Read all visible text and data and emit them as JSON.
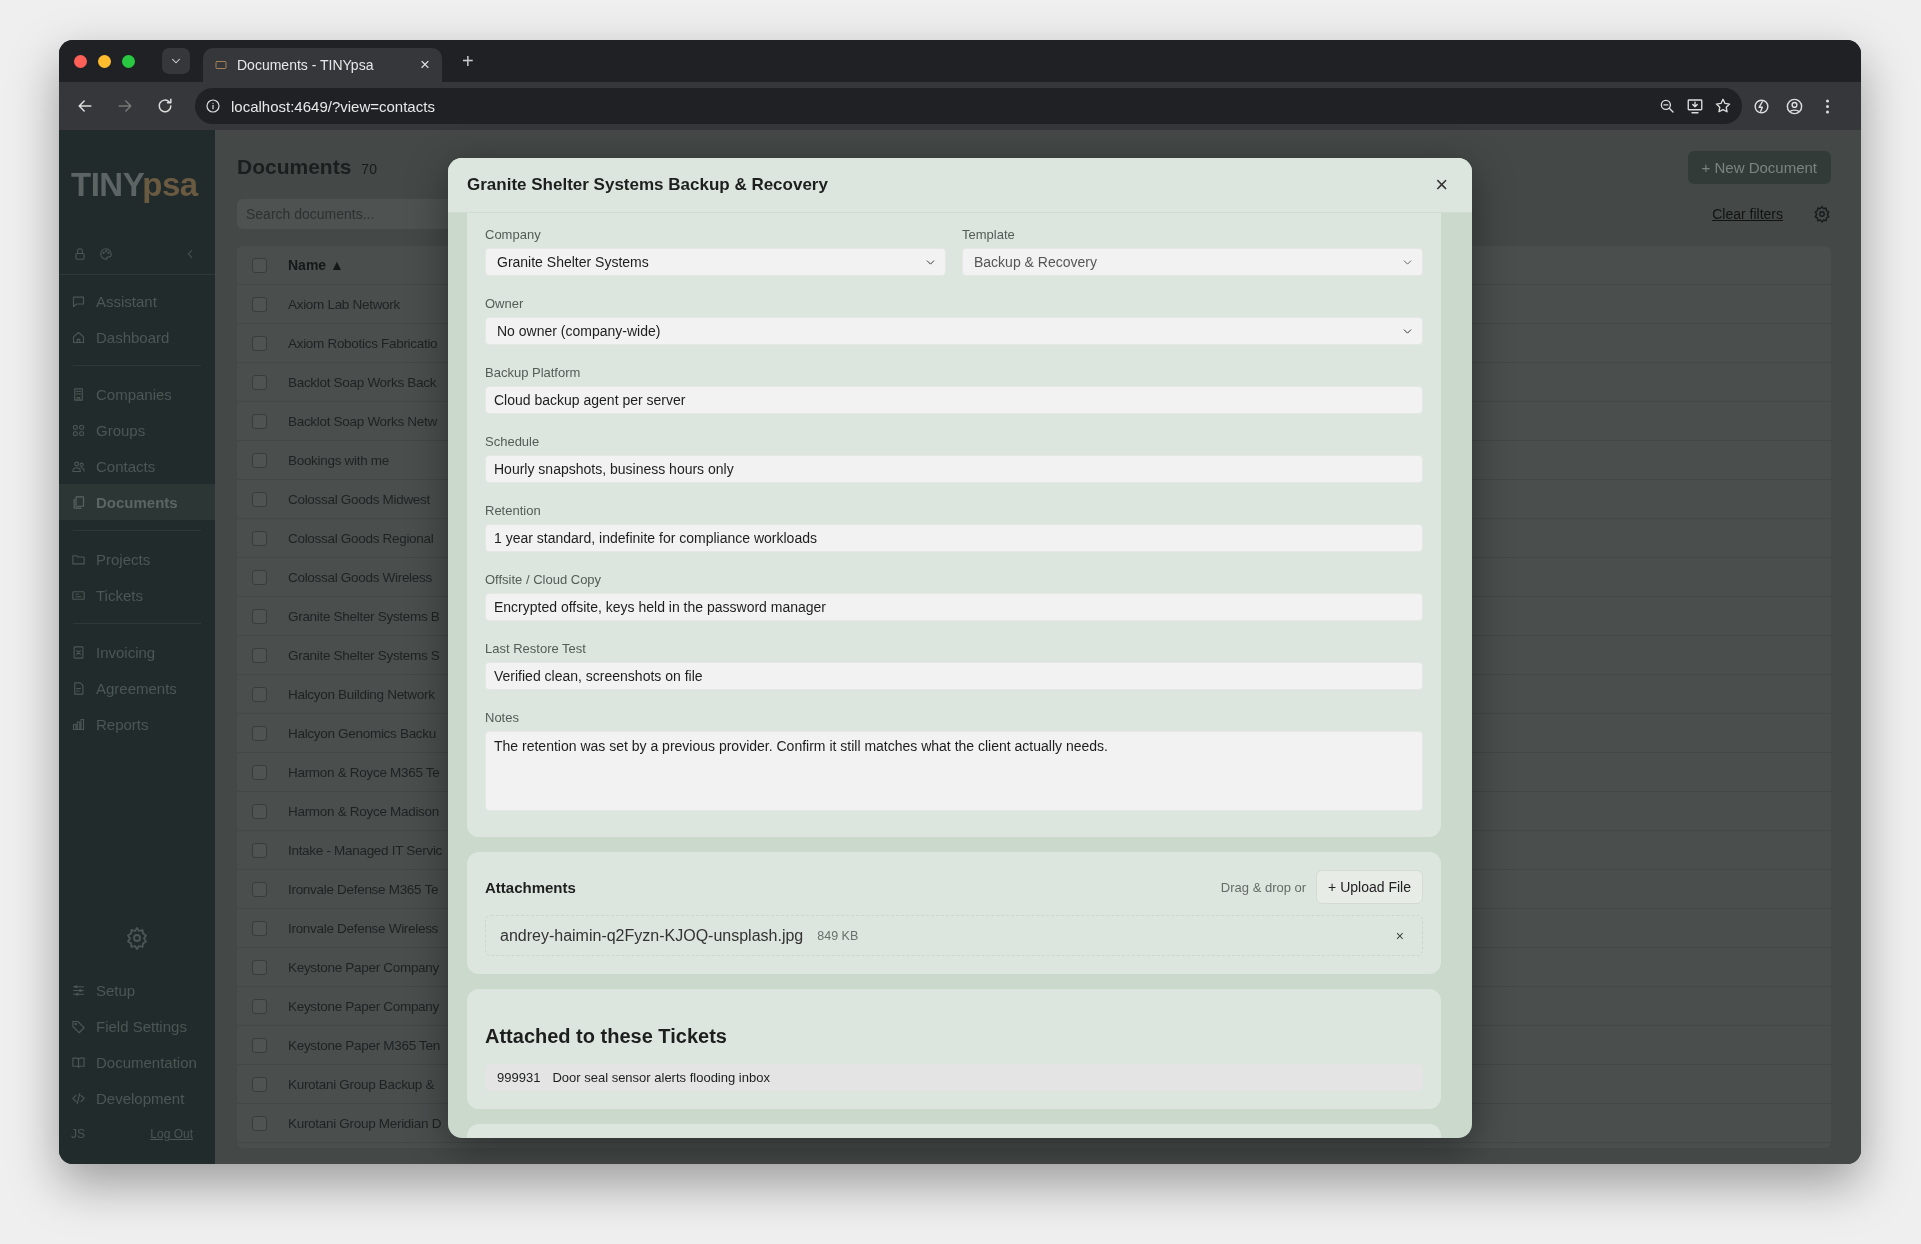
{
  "browser": {
    "tab_title": "Documents - TINYpsa",
    "tab_close": "×",
    "new_tab": "+",
    "url": "localhost:4649/?view=contacts",
    "forward_disabled": true
  },
  "sidebar": {
    "logo_main": "TINY",
    "logo_accent": "psa",
    "sections": [
      {
        "items": [
          {
            "label": "Assistant",
            "selected": false
          },
          {
            "label": "Dashboard",
            "selected": false
          }
        ]
      },
      {
        "items": [
          {
            "label": "Companies",
            "selected": false
          },
          {
            "label": "Groups",
            "selected": false
          },
          {
            "label": "Contacts",
            "selected": false
          },
          {
            "label": "Documents",
            "selected": true
          }
        ]
      },
      {
        "items": [
          {
            "label": "Projects",
            "selected": false
          },
          {
            "label": "Tickets",
            "selected": false
          }
        ]
      },
      {
        "items": [
          {
            "label": "Invoicing",
            "selected": false
          },
          {
            "label": "Agreements",
            "selected": false
          },
          {
            "label": "Reports",
            "selected": false
          }
        ]
      }
    ],
    "bottom_items": [
      {
        "label": "Setup",
        "selected": false
      },
      {
        "label": "Field Settings",
        "selected": false
      },
      {
        "label": "Documentation",
        "selected": false
      },
      {
        "label": "Development",
        "selected": false
      }
    ],
    "user_initials": "JS",
    "logout": "Log Out"
  },
  "main": {
    "title": "Documents",
    "count": "70",
    "search": {
      "placeholder": "Search documents..."
    },
    "new_button": "+ New Document",
    "clear_filters": "Clear filters",
    "table": {
      "header_checked": false,
      "columns": [
        {
          "label": "Name",
          "sort": "▲"
        }
      ],
      "rows": [
        {
          "name": "Axiom Lab Network",
          "checked": false
        },
        {
          "name": "Axiom Robotics Fabricatio",
          "checked": false
        },
        {
          "name": "Backlot Soap Works Back",
          "checked": false
        },
        {
          "name": "Backlot Soap Works Netw",
          "checked": false
        },
        {
          "name": "Bookings with me",
          "checked": false
        },
        {
          "name": "Colossal Goods Midwest",
          "checked": false
        },
        {
          "name": "Colossal Goods Regional",
          "checked": false
        },
        {
          "name": "Colossal Goods Wireless",
          "checked": false
        },
        {
          "name": "Granite Shelter Systems B",
          "checked": false
        },
        {
          "name": "Granite Shelter Systems S",
          "checked": false
        },
        {
          "name": "Halcyon Building Network",
          "checked": false
        },
        {
          "name": "Halcyon Genomics Backu",
          "checked": false
        },
        {
          "name": "Harmon & Royce M365 Te",
          "checked": false
        },
        {
          "name": "Harmon & Royce Madison",
          "checked": false
        },
        {
          "name": "Intake - Managed IT Servic",
          "checked": false
        },
        {
          "name": "Ironvale Defense M365 Te",
          "checked": false
        },
        {
          "name": "Ironvale Defense Wireless",
          "checked": false
        },
        {
          "name": "Keystone Paper Company",
          "checked": false
        },
        {
          "name": "Keystone Paper Company",
          "checked": false
        },
        {
          "name": "Keystone Paper M365 Ten",
          "checked": false
        },
        {
          "name": "Kurotani Group Backup &",
          "checked": false
        },
        {
          "name": "Kurotani Group Meridian D",
          "checked": false
        }
      ]
    }
  },
  "modal": {
    "title": "Granite Shelter Systems Backup & Recovery",
    "close": "×",
    "rows": [
      [
        {
          "kind": "select",
          "label": "Company",
          "value": "Granite Shelter Systems",
          "disabled": false
        },
        {
          "kind": "select",
          "label": "Template",
          "value": "Backup & Recovery",
          "disabled": true
        }
      ],
      [
        {
          "kind": "select",
          "label": "Owner",
          "value": "No owner (company-wide)",
          "disabled": false
        }
      ],
      [
        {
          "kind": "input",
          "label": "Backup Platform",
          "value": "Cloud backup agent per server"
        }
      ],
      [
        {
          "kind": "input",
          "label": "Schedule",
          "value": "Hourly snapshots, business hours only"
        }
      ],
      [
        {
          "kind": "input",
          "label": "Retention",
          "value": "1 year standard, indefinite for compliance workloads"
        }
      ],
      [
        {
          "kind": "input",
          "label": "Offsite / Cloud Copy",
          "value": "Encrypted offsite, keys held in the password manager"
        }
      ],
      [
        {
          "kind": "input",
          "label": "Last Restore Test",
          "value": "Verified clean, screenshots on file"
        }
      ],
      [
        {
          "kind": "textarea",
          "label": "Notes",
          "value": "The retention was set by a previous provider. Confirm it still matches what the client actually needs."
        }
      ]
    ],
    "attachments": {
      "title": "Attachments",
      "hint": "Drag & drop or",
      "upload_button": "+ Upload File",
      "files": [
        {
          "name": "andrey-haimin-q2Fyzn-KJOQ-unsplash.jpg",
          "size": "849 KB",
          "remove": "×"
        }
      ]
    },
    "tickets": {
      "title": "Attached to these Tickets",
      "items": [
        {
          "number": "999931",
          "title": "Door seal sensor alerts flooding inbox"
        }
      ]
    }
  }
}
